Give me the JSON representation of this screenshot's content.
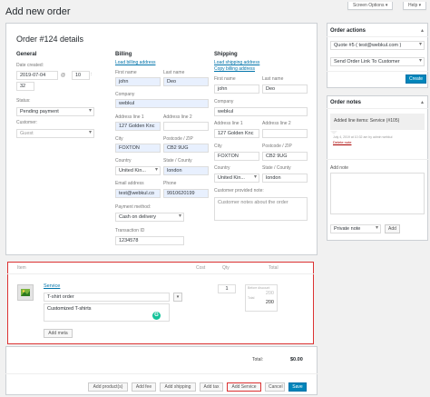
{
  "page": {
    "title": "Add new order",
    "screen_options_label": "Screen Options ▾",
    "help_label": "Help ▾"
  },
  "order": {
    "heading": "Order #124 details",
    "general": {
      "heading": "General",
      "date_label": "Date created:",
      "date_value": "2019-07-04",
      "at_label": "@",
      "hour_value": "10",
      "minute_value": "32",
      "status_label": "Status:",
      "status_value": "Pending payment",
      "customer_label": "Customer:",
      "customer_value": "Guest"
    },
    "billing": {
      "heading": "Billing",
      "load_link": "Load billing address",
      "first_name_label": "First name",
      "first_name": "john",
      "last_name_label": "Last name",
      "last_name": "Deo",
      "company_label": "Company",
      "company": "webkul",
      "addr1_label": "Address line 1",
      "addr1": "127 Golden Knc",
      "addr2_label": "Address line 2",
      "addr2": "",
      "city_label": "City",
      "city": "FOXTON",
      "postcode_label": "Postcode / ZIP",
      "postcode": "CB2 9UG",
      "country_label": "Country",
      "country": "United Kin...",
      "state_label": "State / County",
      "state": "london",
      "email_label": "Email address",
      "email": "test@webkul.co",
      "phone_label": "Phone",
      "phone": "9910620199",
      "payment_label": "Payment method:",
      "payment": "Cash on delivery",
      "txn_label": "Transaction ID",
      "txn": "1234578"
    },
    "shipping": {
      "heading": "Shipping",
      "load_link": "Load shipping address",
      "copy_link": "Copy billing address",
      "first_name_label": "First name",
      "first_name": "john",
      "last_name_label": "Last name",
      "last_name": "Deo",
      "company_label": "Company",
      "company": "webkul",
      "addr1_label": "Address line 1",
      "addr1": "127 Golden Knc",
      "addr2_label": "Address line 2",
      "addr2": "",
      "city_label": "City",
      "city": "FOXTON",
      "postcode_label": "Postcode / ZIP",
      "postcode": "CB2 9UG",
      "country_label": "Country",
      "country": "United Kin...",
      "state_label": "State / County",
      "state": "london",
      "note_label": "Customer provided note:",
      "note_placeholder": "Customer notes about the order"
    }
  },
  "items": {
    "col_item": "Item",
    "col_cost": "Cost",
    "col_qty": "Qty",
    "col_total": "Total",
    "service_link": "Service",
    "service_title": "T-shirt order",
    "service_desc": "Customized T-shirts",
    "grammarly_badge": "G",
    "qty_value": "1",
    "before_discount_label": "Before discount",
    "before_discount_value": "200",
    "total_label": "Total",
    "total_value": "200",
    "add_meta_label": "Add meta",
    "grand_total_label": "Total:",
    "grand_total_value": "$0.00"
  },
  "actions_bar": {
    "add_products": "Add product(s)",
    "add_fee": "Add fee",
    "add_shipping": "Add shipping",
    "add_tax": "Add tax",
    "add_service": "Add Service",
    "cancel": "Cancel",
    "save": "Save"
  },
  "order_actions": {
    "heading": "Order actions",
    "quote_value": "Quote #5 ( test@webkul.com )",
    "action_value": "Send Order Link To Customer",
    "create_label": "Create"
  },
  "order_notes": {
    "heading": "Order notes",
    "note_text": "Added line items: Service (#105)",
    "note_meta": "July 4, 2019 at 10:32 am by admin webkul",
    "delete_label": "Delete note",
    "add_note_label": "Add note",
    "note_type_value": "Private note",
    "add_button_label": "Add"
  },
  "colors": {
    "accent": "#0073aa",
    "primary_button": "#0085ba",
    "highlight_border": "#dc3232",
    "autofill_bg": "#e8f0fe",
    "grammarly_green": "#15c39a",
    "delete_red": "#a00"
  },
  "icons": {
    "product_thumb": "image-placeholder-icon",
    "grammarly": "grammarly-icon",
    "panel_toggle": "chevron-up-icon"
  }
}
